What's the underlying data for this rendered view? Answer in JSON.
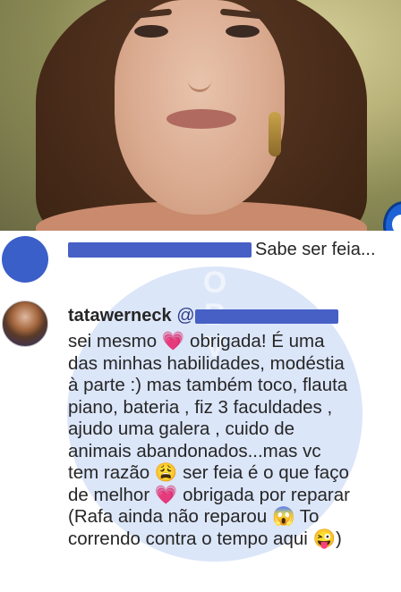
{
  "comment1": {
    "text": "Sabe ser feia..."
  },
  "comment2": {
    "username": "tatawerneck",
    "mention": "@",
    "lines": [
      [
        "sei mesmo ",
        "💗",
        " obrigada! É uma"
      ],
      [
        "das minhas habilidades, modéstia"
      ],
      [
        "à parte :) mas também toco, flauta"
      ],
      [
        "piano, bateria , fiz 3 faculdades ,"
      ],
      [
        "ajudo uma galera , cuido de"
      ],
      [
        "animais abandonados...mas vc"
      ],
      [
        "tem razão ",
        "😩",
        " ser feia é o que faço"
      ],
      [
        "de melhor ",
        "💗",
        " obrigada por reparar"
      ],
      [
        "(Rafa ainda não reparou ",
        "😱",
        " To"
      ],
      [
        "correndo contra o tempo aqui ",
        "😜",
        ")"
      ]
    ]
  },
  "colors": {
    "redaction": "#4760c6",
    "watermark": "#82a5eb",
    "avatar": "#3b5fc8"
  }
}
